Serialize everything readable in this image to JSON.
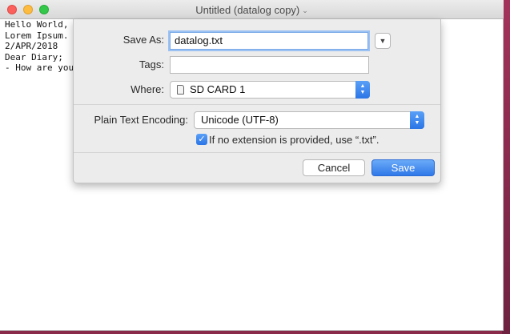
{
  "window": {
    "title": "Untitled (datalog copy)"
  },
  "editor": {
    "text": "Hello World,\nLorem Ipsum.\n2/APR/2018\nDear Diary;\n- How are you"
  },
  "save_dialog": {
    "save_as_label": "Save As:",
    "save_as_value": "datalog.txt",
    "tags_label": "Tags:",
    "tags_value": "",
    "where_label": "Where:",
    "where_value": "SD CARD 1",
    "encoding_label": "Plain Text Encoding:",
    "encoding_value": "Unicode (UTF-8)",
    "extension_checkbox_label": "If no extension is provided, use “.txt”.",
    "extension_checked": true,
    "cancel_label": "Cancel",
    "save_label": "Save"
  },
  "icons": {
    "where_icon": "sd-card-icon",
    "expand_icon": "chevron-down-icon",
    "popup_icon": "up-down-chevron-icon"
  },
  "colors": {
    "accent": "#2f78e8",
    "desktop": "#8a2a4a"
  }
}
